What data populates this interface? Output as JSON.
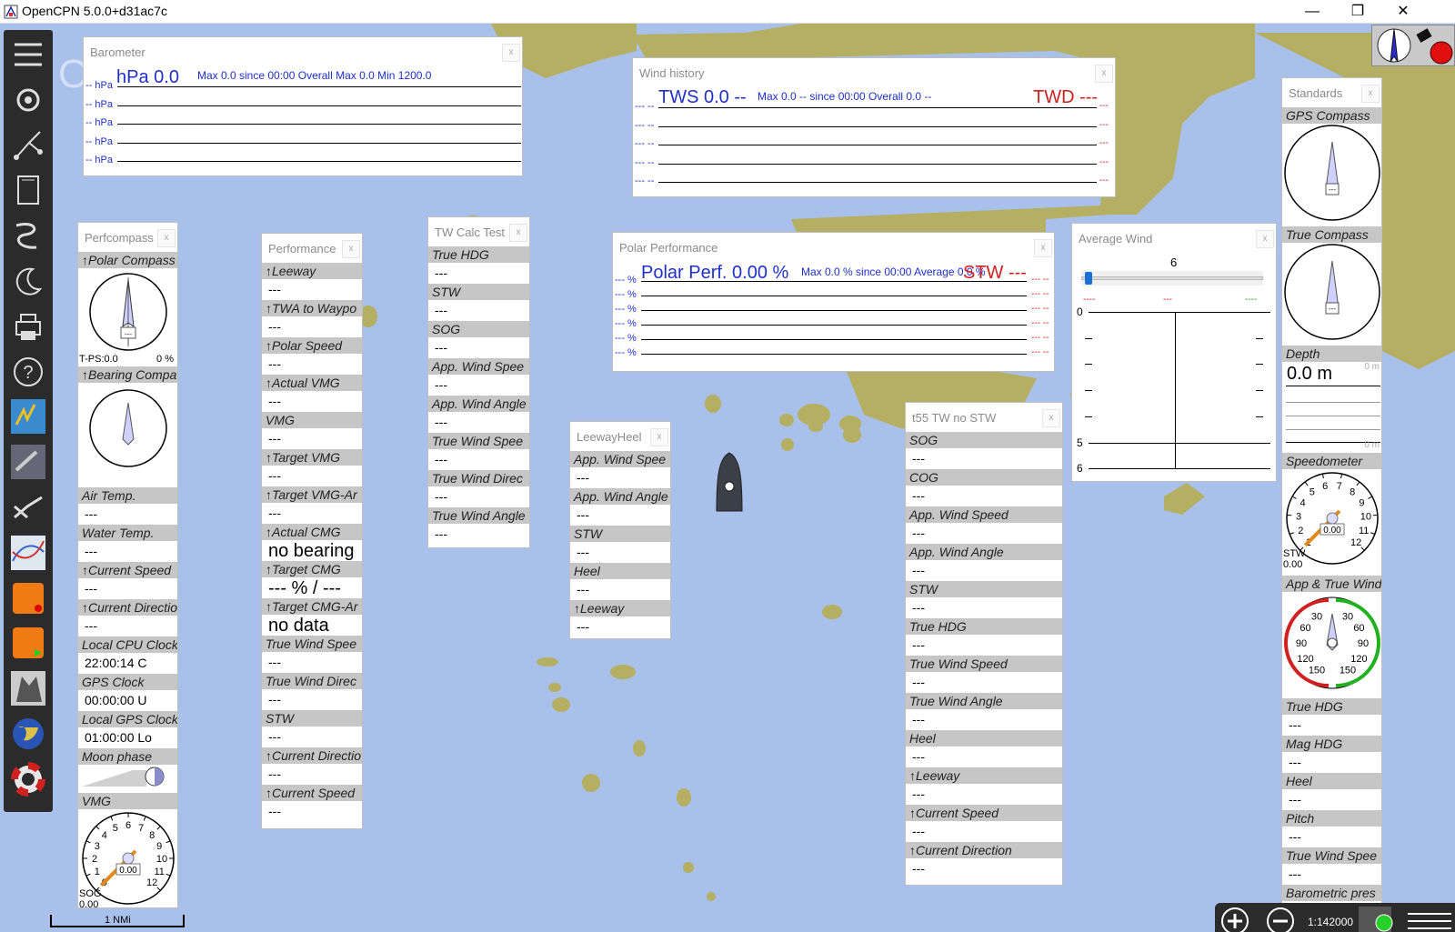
{
  "window": {
    "title": "OpenCPN 5.0.0+d31ac7c"
  },
  "toolbar": {
    "buttons": [
      "menu-icon",
      "gear-icon",
      "route-icon",
      "layers-icon",
      "track-icon",
      "moon-star-icon",
      "print-icon",
      "help-icon",
      "plugin-weather-icon",
      "plugin-tool-icon",
      "plugin-chart-icon",
      "plugin-grib-icon",
      "plugin-orange-icon",
      "plugin-orange2-icon",
      "plugin-wolf-icon",
      "plugin-globe-icon",
      "lifebuoy-icon"
    ]
  },
  "barometer": {
    "title": "Barometer",
    "header": "hPa 0.0",
    "stats": "Max 0.0 since 00:00  Overall Max 0.0 Min 1200.0",
    "axis": [
      "-- hPa",
      "-- hPa",
      "-- hPa",
      "-- hPa",
      "-- hPa"
    ]
  },
  "wind_history": {
    "title": "Wind history",
    "tws": "TWS 0.0 --",
    "stats": "Max 0.0 -- since 00:00  Overall 0.0 --",
    "twd": "TWD ---",
    "left_axis": [
      "--- --",
      "--- --",
      "--- --",
      "--- --",
      "--- --"
    ],
    "right_axis": [
      "---",
      "---",
      "---",
      "---",
      "---"
    ]
  },
  "polar_performance": {
    "title": "Polar Performance",
    "header": "Polar Perf. 0.00 %",
    "stats": "Max 0.0 % since 00:00   Average 0.0 %",
    "stw": "STW ---",
    "left_axis": [
      "--- %",
      "--- %",
      "--- %",
      "--- %",
      "--- %",
      "--- %"
    ],
    "right_axis": [
      "--- --",
      "--- --",
      "--- --",
      "--- --",
      "--- --",
      "--- --"
    ]
  },
  "average_wind": {
    "title": "Average Wind",
    "slider_value": "6",
    "left_val": "----",
    "mid_val": "---",
    "right_val": "----",
    "y_top": "0",
    "y_5": "5",
    "y_6": "6"
  },
  "perfcompass": {
    "title": "Perfcompass",
    "polar_compass_label": "↑Polar Compass",
    "polar_left": "T-PS:0.0",
    "polar_right": "0 %",
    "bearing_label": "↑Bearing Compa",
    "items": [
      {
        "name": "Air Temp.",
        "value": "---"
      },
      {
        "name": "Water Temp.",
        "value": "---"
      },
      {
        "name": "↑Current Speed",
        "value": "---"
      },
      {
        "name": "↑Current Directio",
        "value": "---"
      },
      {
        "name": "Local CPU Clock",
        "value": "22:00:14 C"
      },
      {
        "name": "GPS Clock",
        "value": "00:00:00 U"
      },
      {
        "name": "Local GPS Clock",
        "value": "01:00:00 Lo"
      }
    ],
    "moon_label": "Moon phase",
    "vmg_label": "VMG",
    "vmg_dial": {
      "ticks": [
        "0",
        "1",
        "2",
        "3",
        "4",
        "5",
        "6",
        "7",
        "8",
        "9",
        "10",
        "11",
        "12"
      ],
      "value": "0.00",
      "sub": "SOG",
      "sub_value": "0.00"
    }
  },
  "performance": {
    "title": "Performance",
    "items": [
      {
        "name": "↑Leeway",
        "value": "---"
      },
      {
        "name": "↑TWA to Waypo",
        "value": "---"
      },
      {
        "name": "↑Polar Speed",
        "value": "---"
      },
      {
        "name": "↑Actual VMG",
        "value": "---"
      },
      {
        "name": "VMG",
        "value": "---"
      },
      {
        "name": "↑Target VMG",
        "value": "---"
      },
      {
        "name": "↑Target VMG-Ar",
        "value": "---"
      },
      {
        "name": "↑Actual CMG",
        "value": "no bearing",
        "big": true
      },
      {
        "name": "↑Target CMG",
        "value": "--- % / ---",
        "big": true
      },
      {
        "name": "↑Target CMG-Ar",
        "value": "no data",
        "big": true
      },
      {
        "name": "True Wind Spee",
        "value": "---"
      },
      {
        "name": "True Wind Direc",
        "value": "---"
      },
      {
        "name": "STW",
        "value": "---"
      },
      {
        "name": "↑Current Directio",
        "value": "---"
      },
      {
        "name": "↑Current Speed",
        "value": "---"
      }
    ]
  },
  "tw_calc": {
    "title": "TW Calc Test",
    "items": [
      {
        "name": "True HDG",
        "value": "---"
      },
      {
        "name": "STW",
        "value": "---"
      },
      {
        "name": "SOG",
        "value": "---"
      },
      {
        "name": "App. Wind Spee",
        "value": "---"
      },
      {
        "name": "App. Wind Angle",
        "value": "---"
      },
      {
        "name": "True Wind Spee",
        "value": "---"
      },
      {
        "name": "True Wind Direc",
        "value": "---"
      },
      {
        "name": "True Wind Angle",
        "value": "---"
      }
    ]
  },
  "leewayheel": {
    "title": "LeewayHeel",
    "items": [
      {
        "name": "App. Wind Spee",
        "value": "---"
      },
      {
        "name": "App. Wind Angle",
        "value": "---"
      },
      {
        "name": "STW",
        "value": "---"
      },
      {
        "name": "Heel",
        "value": "---"
      },
      {
        "name": "↑Leeway",
        "value": "---"
      }
    ]
  },
  "t55": {
    "title": "t55 TW no STW",
    "items": [
      {
        "name": "SOG",
        "value": "---"
      },
      {
        "name": "COG",
        "value": "---"
      },
      {
        "name": "App. Wind Speed",
        "value": "---"
      },
      {
        "name": "App. Wind Angle",
        "value": "---"
      },
      {
        "name": "STW",
        "value": "---"
      },
      {
        "name": "True HDG",
        "value": "---"
      },
      {
        "name": "True Wind Speed",
        "value": "---"
      },
      {
        "name": "True Wind Angle",
        "value": "---"
      },
      {
        "name": "Heel",
        "value": "---"
      },
      {
        "name": "↑Leeway",
        "value": "---"
      },
      {
        "name": "↑Current Speed",
        "value": "---"
      },
      {
        "name": "↑Current Direction",
        "value": "---"
      }
    ]
  },
  "standards": {
    "title": "Standards",
    "gps_compass": "GPS Compass",
    "true_compass": "True Compass",
    "depth_label": "Depth",
    "depth_value": "0.0 m",
    "depth_top": "0 m",
    "depth_bottom": "0 m",
    "speedometer": "Speedometer",
    "speedo": {
      "ticks": [
        "1",
        "2",
        "3",
        "4",
        "5",
        "6",
        "7",
        "8",
        "9",
        "10",
        "11",
        "12"
      ],
      "value": "0.00",
      "sub": "STW",
      "sub_value": "0.00"
    },
    "app_true_wind": "App & True Wind",
    "wind_ticks": [
      "30",
      "30",
      "60",
      "60",
      "90",
      "90",
      "120",
      "120",
      "150",
      "150"
    ],
    "items": [
      {
        "name": "True HDG",
        "value": "---"
      },
      {
        "name": "Mag HDG",
        "value": "---"
      },
      {
        "name": "Heel",
        "value": "---"
      },
      {
        "name": "Pitch",
        "value": "---"
      },
      {
        "name": "True Wind Spee",
        "value": "---"
      },
      {
        "name": "Barometric pres",
        "value": ""
      }
    ]
  },
  "status": {
    "scale": "1:142000",
    "scale_bar": "1 NMi"
  },
  "colors": {
    "water": "#a9c0ea",
    "land": "#b4af62",
    "toolbar": "#2b2b2b",
    "item_header": "#c6c6c6",
    "graph_blue": "#1e2fcc",
    "graph_red": "#d02020"
  }
}
